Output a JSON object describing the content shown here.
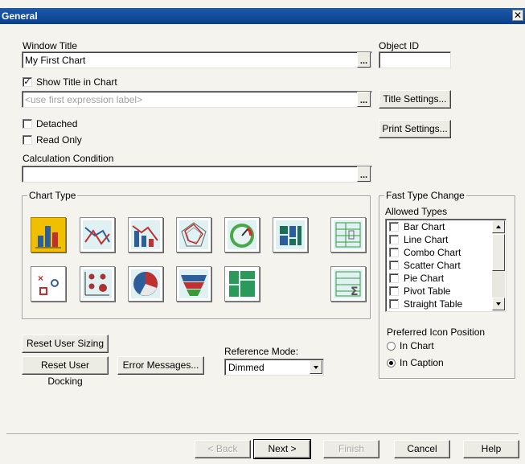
{
  "window": {
    "title": "General",
    "close_glyph": "✕"
  },
  "window_title": {
    "label": "Window Title",
    "value": "My First Chart",
    "ellipsis": "..."
  },
  "object_id": {
    "label": "Object ID",
    "value": ""
  },
  "show_title": {
    "label": "Show Title in Chart",
    "checked": true,
    "placeholder": "<use first expression label>",
    "ellipsis": "..."
  },
  "title_settings_label": "Title Settings...",
  "print_settings_label": "Print Settings...",
  "detached": {
    "label": "Detached",
    "checked": false
  },
  "read_only": {
    "label": "Read Only",
    "checked": false
  },
  "calc_condition": {
    "label": "Calculation Condition",
    "value": "",
    "ellipsis": "..."
  },
  "chart_type": {
    "label": "Chart Type",
    "icons": [
      "bar-chart-icon",
      "line-chart-icon",
      "combo-chart-icon",
      "radar-chart-icon",
      "gauge-chart-icon",
      "mekko-chart-icon",
      "pivot-table-icon",
      "scatter-chart-icon",
      "grid-chart-icon",
      "pie-chart-icon",
      "funnel-chart-icon",
      "block-chart-icon",
      "straight-table-icon"
    ],
    "selected": "bar-chart-icon"
  },
  "fast_type_change": {
    "label": "Fast Type Change",
    "allowed_label": "Allowed Types",
    "types": [
      "Bar Chart",
      "Line Chart",
      "Combo Chart",
      "Scatter Chart",
      "Pie Chart",
      "Pivot Table",
      "Straight Table"
    ],
    "preferred_label": "Preferred Icon Position",
    "positions": [
      "In Chart",
      "In Caption"
    ],
    "selected_position": "In Caption"
  },
  "reset_sizing_label": "Reset User Sizing",
  "reset_docking_label": "Reset User Docking",
  "error_messages_label": "Error Messages...",
  "reference_mode": {
    "label": "Reference Mode:",
    "value": "Dimmed"
  },
  "footer": {
    "back": "< Back",
    "next": "Next >",
    "finish": "Finish",
    "cancel": "Cancel",
    "help": "Help"
  },
  "colors": {
    "titlebar": "#0b3f8a",
    "dialog_bg": "#f4f3ee",
    "selected_icon": "#f0c000"
  }
}
